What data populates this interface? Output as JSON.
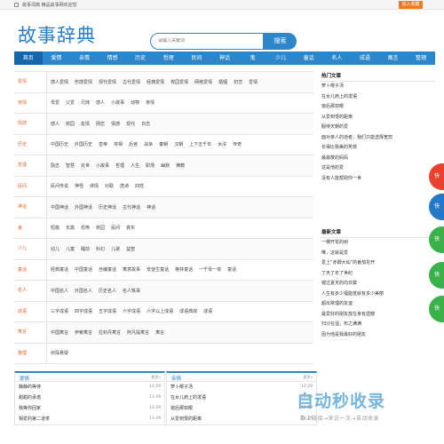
{
  "topbar": {
    "site_name": "故事词典 精品故事网欢迎您",
    "fav_label": "加入收藏"
  },
  "header": {
    "logo": "故事辞典",
    "search_placeholder": "请输入关键词",
    "search_button": "搜索"
  },
  "nav": [
    "首页",
    "爱情",
    "亲情",
    "情感",
    "历史",
    "哲理",
    "民间",
    "神话",
    "鬼",
    "少儿",
    "童话",
    "名人",
    "成语",
    "寓言",
    "整理"
  ],
  "categories": [
    {
      "name": "爱情",
      "links": [
        "感人爱情",
        "伤感爱情",
        "现代爱情",
        "古代爱情",
        "经典爱情",
        "校园爱情",
        "网络爱情",
        "婚姻",
        "初恋",
        "爱情"
      ]
    },
    {
      "name": "亲情",
      "links": [
        "母爱",
        "父爱",
        "兄妹",
        "感人",
        "小故事",
        "动物",
        "亲情"
      ]
    },
    {
      "name": "情感",
      "links": [
        "感人",
        "校园",
        "友情",
        "网恋",
        "情感",
        "现代",
        "日志"
      ]
    },
    {
      "name": "历史",
      "links": [
        "中国历史",
        "外国历史",
        "皇帝",
        "将相",
        "后宫",
        "战争",
        "秦朝",
        "汉朝",
        "上下五千年",
        "水浒",
        "传奇"
      ]
    },
    {
      "name": "哲理",
      "links": [
        "励志",
        "智慧",
        "处世",
        "小故事",
        "哲理",
        "人生",
        "职场",
        "幽默",
        "佛教"
      ]
    },
    {
      "name": "民间",
      "links": [
        "民间传说",
        "神怪",
        "侠情",
        "对联",
        "唐诗",
        "四姓"
      ]
    },
    {
      "name": "神话",
      "links": [
        "中国神话",
        "外国神话",
        "历史神话",
        "古代神话",
        "神话"
      ]
    },
    {
      "name": "鬼",
      "links": [
        "短篇",
        "长篇",
        "恐怖",
        "校园",
        "民间",
        "真实"
      ]
    },
    {
      "name": "少儿",
      "links": [
        "幼儿",
        "儿童",
        "睡前",
        "科幻",
        "儿歌",
        "益智"
      ]
    },
    {
      "name": "童话",
      "links": [
        "经典童话",
        "中国童话",
        "自编童话",
        "寓意故事",
        "安徒生童话",
        "格林童话",
        "一千零一夜",
        "童话"
      ]
    },
    {
      "name": "名人",
      "links": [
        "中国名人",
        "外国名人",
        "历史名人",
        "名人轶事"
      ]
    },
    {
      "name": "成语",
      "links": [
        "三字成语",
        "四字成语",
        "五字成语",
        "六字成语",
        "六字以上成语",
        "成语典故",
        "成语"
      ]
    },
    {
      "name": "寓言",
      "links": [
        "中国寓言",
        "伊索寓言",
        "拉封丹寓言",
        "阿凡提寓言",
        "寓言"
      ]
    },
    {
      "name": "整理",
      "links": [
        "侦探悬疑"
      ]
    }
  ],
  "hot": {
    "title": "热门文章",
    "items": [
      "萝卜缨子汤",
      "在女儿肩上的泼语",
      "窗后那双眼",
      "从爱到恨的距离",
      "服侍天朝的爱",
      "面对亲人的逝者，我们只能选择宽恕",
      "长得比我美的男孩",
      "最最敬的妈妈",
      "这是他的爱",
      "没有人能帮助你一世"
    ]
  },
  "latest": {
    "title": "最新文章",
    "items": [
      "一棵开花的树",
      "唯，这就是爱",
      "爱上“赤脚大仙”的番茄花开",
      "了天了年了世纪",
      "镜过夏天的向日葵",
      "人生有多少福能抵就有多少美丽",
      "超出常理的友谊",
      "最爱好的朋友放在身有遗憾",
      "归沙在湿，布之满满",
      "因为他是我最好的朋友"
    ]
  },
  "bottom": [
    {
      "title": "爱情",
      "more": "更多»",
      "items": [
        {
          "text": "静静的等待",
          "date": "11-29"
        },
        {
          "text": "甜甜的承诺",
          "date": "11-29"
        },
        {
          "text": "我等你回家",
          "date": "11-29"
        },
        {
          "text": "相爱的第二道茶",
          "date": "11-29"
        }
      ]
    },
    {
      "title": "亲情",
      "more": "更多»",
      "items": [
        {
          "text": "萝卜缨子汤",
          "date": "11-29"
        },
        {
          "text": "在女儿肩上的泼语",
          "date": "11-29"
        },
        {
          "text": "窗后那双眼",
          "date": "11-29"
        },
        {
          "text": "从爱到恨的距离",
          "date": "11-29"
        }
      ]
    }
  ],
  "floats": [
    "快",
    "快",
    "快",
    "快",
    "快"
  ],
  "watermark": {
    "logo": "自动秒收录",
    "sub": "数上链接→来访一次→自动收录"
  },
  "colors": {
    "primary": "#2e86c8",
    "nav_active": "#1565a8",
    "category": "#e06a32",
    "fav_button": "#f07a22"
  }
}
